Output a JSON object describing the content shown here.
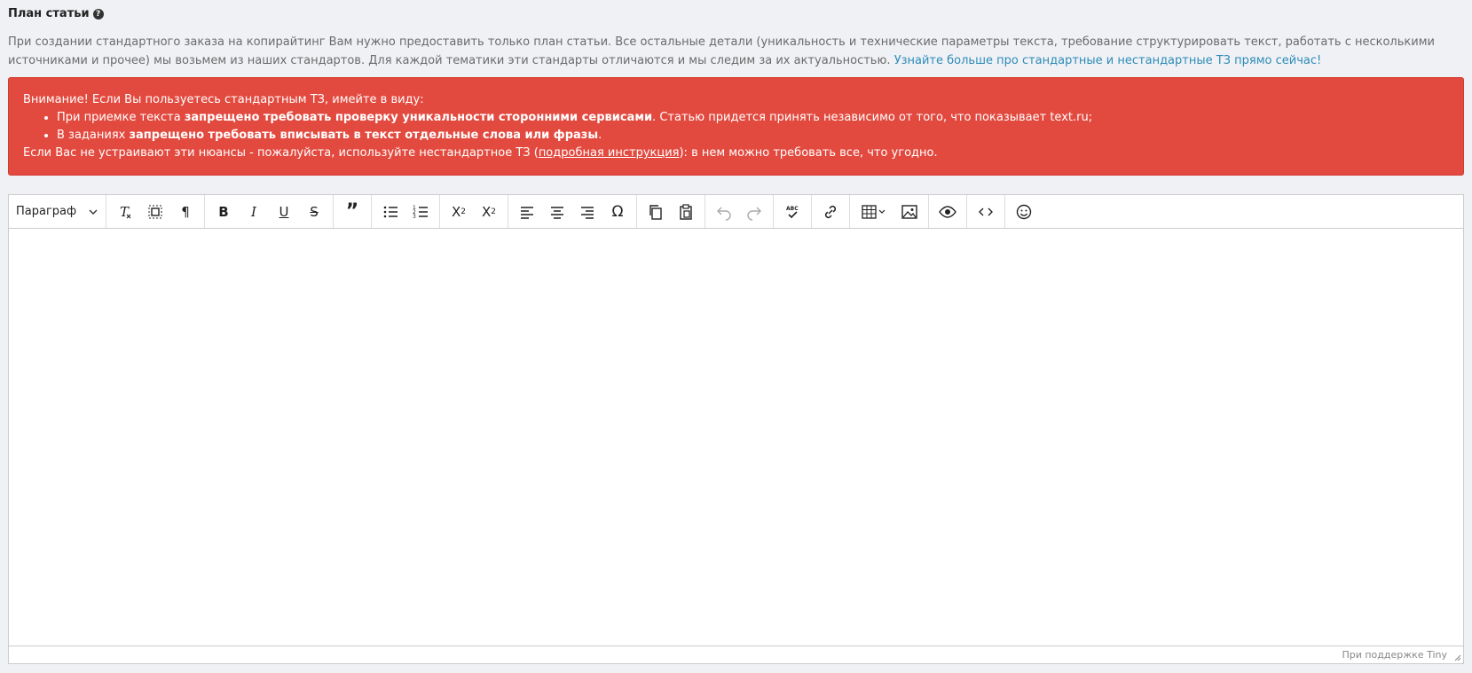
{
  "title": "План статьи",
  "description": {
    "text": "При создании стандартного заказа на копирайтинг Вам нужно предоставить только план статьи. Все остальные детали (уникальность и технические параметры текста, требование структурировать текст, работать с несколькими источниками и прочее) мы возьмем из наших стандартов. Для каждой тематики эти стандарты отличаются и мы следим за их актуальностью.",
    "link": "Узнайте больше про стандартные и нестандартные ТЗ прямо сейчас!"
  },
  "alert": {
    "heading": "Внимание! Если Вы пользуетесь стандартным ТЗ, имейте в виду:",
    "item1_pre": "При приемке текста ",
    "item1_bold": "запрещено требовать проверку уникальности сторонними сервисами",
    "item1_post": ". Статью придется принять независимо от того, что показывает text.ru;",
    "item2_pre": "В заданиях ",
    "item2_bold": "запрещено требовать вписывать в текст отдельные слова или фразы",
    "item2_post": ".",
    "footer_pre": "Если Вас не устраивают эти нюансы - пожалуйста, используйте нестандартное ТЗ (",
    "footer_link": "подробная инструкция",
    "footer_post": "): в нем можно требовать все, что угодно.",
    "color": "#e34a3f"
  },
  "editor": {
    "block_format": "Параграф",
    "status": "При поддержке Tiny",
    "toolbar_icons": [
      "clear-format-icon",
      "select-all-icon",
      "pilcrow-icon",
      "bold-icon",
      "italic-icon",
      "underline-icon",
      "strikethrough-icon",
      "blockquote-icon",
      "bullet-list-icon",
      "numbered-list-icon",
      "superscript-icon",
      "subscript-icon",
      "align-left-icon",
      "align-center-icon",
      "align-right-icon",
      "omega-icon",
      "copy-icon",
      "paste-icon",
      "undo-icon",
      "redo-icon",
      "spellcheck-icon",
      "link-icon",
      "table-icon",
      "image-icon",
      "preview-icon",
      "code-icon",
      "emoji-icon"
    ]
  }
}
